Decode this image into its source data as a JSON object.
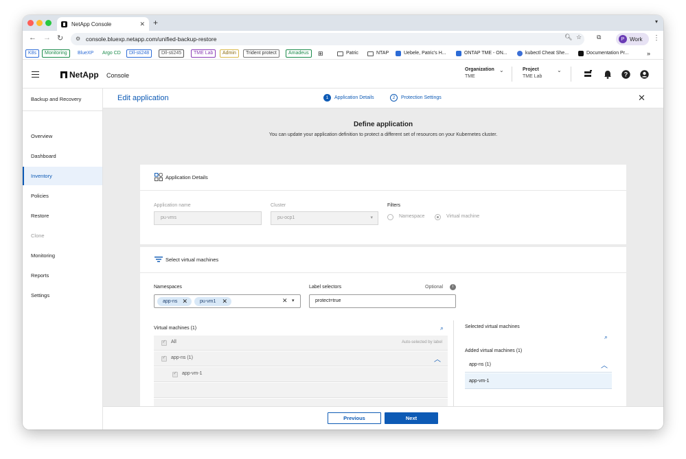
{
  "browser": {
    "tab_title": "NetApp Console",
    "url": "console.bluexp.netapp.com/unified-backup-restore",
    "profile_name": "Work",
    "profile_initial": "P",
    "bookmarks": [
      {
        "label": "K8s",
        "style": "pill",
        "color": "#2c6bd6"
      },
      {
        "label": "Monitoring",
        "style": "pill",
        "color": "#1a8a4a"
      },
      {
        "label": "BlueXP",
        "style": "pill",
        "color": "#2c6bd6"
      },
      {
        "label": "Argo CD",
        "style": "pill",
        "color": "#1a8a4a"
      },
      {
        "label": "Dll-sti248",
        "style": "pill",
        "color": "#2c6bd6"
      },
      {
        "label": "Dll-sti245",
        "style": "pill",
        "color": "#555555"
      },
      {
        "label": "TME Lab",
        "style": "pill",
        "color": "#8a3bb5"
      },
      {
        "label": "Admin",
        "style": "pill",
        "color": "#b58a1a"
      },
      {
        "label": "Trident protect",
        "style": "pill",
        "color": "#555555"
      },
      {
        "label": "Amadeus",
        "style": "pill",
        "color": "#1a8a4a"
      },
      {
        "label": "Patric",
        "style": "folder"
      },
      {
        "label": "NTAP",
        "style": "folder"
      },
      {
        "label": "Uebele, Patric's H...",
        "style": "link"
      },
      {
        "label": "ONTAP TME - ON...",
        "style": "link"
      },
      {
        "label": "kubectl Cheat She...",
        "style": "link"
      },
      {
        "label": "Documentation Pr...",
        "style": "link"
      }
    ],
    "bookmarks_overflow": "»"
  },
  "app": {
    "logo_text": "NetApp",
    "console_label": "Console",
    "organization_label": "Organization",
    "organization_value": "TME",
    "project_label": "Project",
    "project_value": "TME Lab"
  },
  "sidebar": {
    "title": "Backup and Recovery",
    "items": [
      {
        "label": "Overview",
        "state": "normal"
      },
      {
        "label": "Dashboard",
        "state": "normal"
      },
      {
        "label": "Inventory",
        "state": "active"
      },
      {
        "label": "Policies",
        "state": "normal"
      },
      {
        "label": "Restore",
        "state": "normal"
      },
      {
        "label": "Clone",
        "state": "disabled"
      },
      {
        "label": "Monitoring",
        "state": "normal"
      },
      {
        "label": "Reports",
        "state": "normal"
      },
      {
        "label": "Settings",
        "state": "normal"
      }
    ]
  },
  "wizard": {
    "title": "Edit application",
    "steps": [
      {
        "number": "1",
        "label": "Application Details",
        "state": "current"
      },
      {
        "number": "2",
        "label": "Protection Settings",
        "state": "upcoming"
      }
    ],
    "define_title": "Define application",
    "define_subtitle": "You can update your application definition to protect a different set of resources on your Kubernetes cluster."
  },
  "details_card": {
    "heading": "Application Details",
    "app_name_label": "Application name",
    "app_name_value": "pu-vms",
    "cluster_label": "Cluster",
    "cluster_value": "pu-ocp1",
    "filters_label": "Filters",
    "filter_options": [
      "Namespace",
      "Virtual machine"
    ],
    "filter_selected": "Virtual machine"
  },
  "vm_card": {
    "heading": "Select virtual machines",
    "namespaces_label": "Namespaces",
    "namespaces": [
      "app-ns",
      "pu-vm1"
    ],
    "label_selectors_label": "Label selectors",
    "optional_label": "Optional",
    "label_selectors_value": "protect=true",
    "vm_list_title": "Virtual machines (1)",
    "all_label": "All",
    "auto_selected_note": "Auto-selected by label",
    "group_label": "app-ns (1)",
    "vm_item": "app-vm-1",
    "selected_title": "Selected virtual machines",
    "added_title": "Added virtual machines (1)",
    "selected_group": "app-ns (1)",
    "selected_vm": "app-vm-1"
  },
  "footer": {
    "previous_label": "Previous",
    "next_label": "Next"
  },
  "colors": {
    "accent": "#0d5ab5",
    "active_bg": "#e9f1fb",
    "chip_bg": "#d8e8f7"
  }
}
